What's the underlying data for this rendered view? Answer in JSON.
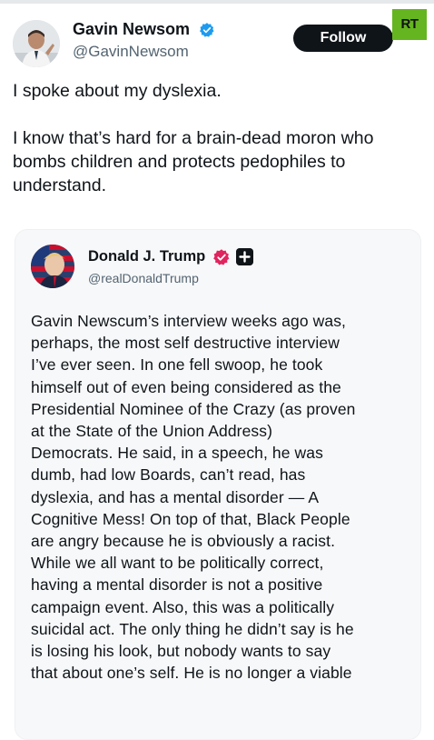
{
  "header": {
    "author_name": "Gavin Newsom",
    "author_handle": "@GavinNewsom",
    "follow_label": "Follow",
    "channel_logo": "RT"
  },
  "tweet": {
    "paragraphs": [
      "I spoke about my dyslexia.",
      "I know that’s hard for a brain-dead moron who bombs children and protects pedophiles to understand."
    ]
  },
  "quote": {
    "author_name": "Donald J. Trump",
    "author_handle": "@realDonaldTrump",
    "lines": [
      "Gavin Newscum’s interview weeks ago was,",
      "perhaps, the most self destructive interview",
      "I’ve ever seen. In one fell swoop, he took",
      "himself out of even being considered as the",
      "Presidential Nominee of the Crazy (as proven",
      "at the State of the Union Address)",
      "Democrats. He said, in a speech, he was",
      "dumb, had low Boards, can’t read, has",
      "dyslexia, and has a mental disorder — A",
      "Cognitive Mess! On top of that, Black People",
      "are angry because he is obviously a racist.",
      "While we all want to be politically correct,",
      "having a mental disorder is not a positive",
      "campaign event. Also, this was a politically",
      "suicidal act. The only thing he didn’t say is he",
      "is losing his look, but nobody wants to say",
      "that about one’s self. He is no longer a viable"
    ]
  },
  "icons": {
    "verified_badge": "verified-badge-icon",
    "quote_badge": "verified-badge-icon",
    "plus_badge": "plus-icon"
  },
  "colors": {
    "verified_blue": "#1d9bf0",
    "quote_badge_pink": "#e0245e",
    "follow_bg": "#0f1419",
    "rt_green": "#64b51f"
  }
}
